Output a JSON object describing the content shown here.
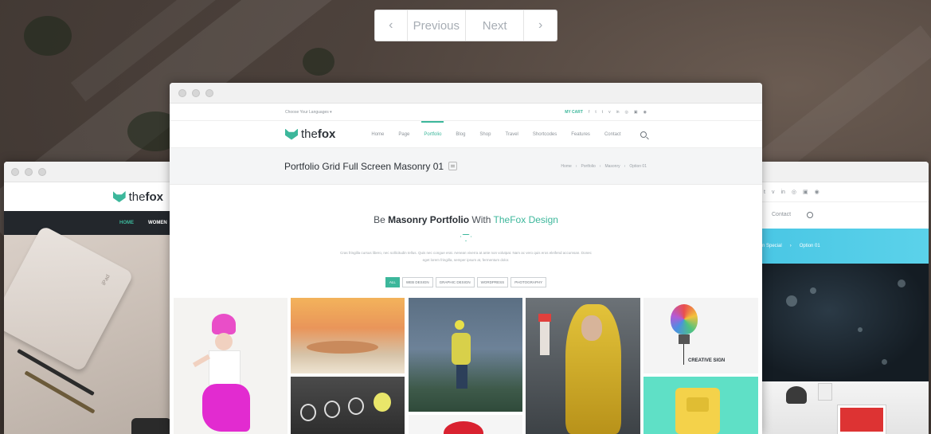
{
  "pager": {
    "prev_arrow": "‹",
    "previous": "Previous",
    "next": "Next",
    "next_arrow": "›"
  },
  "left_window": {
    "logo_pre": "the",
    "logo_bold": "fox",
    "nav": [
      "HOME",
      "WOMEN"
    ],
    "photo_text": "iPad"
  },
  "right_window": {
    "social": [
      "t",
      "v",
      "in",
      "◎",
      "▣",
      "◉"
    ],
    "nav": [
      "Contact"
    ],
    "breadcrumb_a": "n Special",
    "breadcrumb_sep": "›",
    "breadcrumb_b": "Option 01"
  },
  "main_window": {
    "topbar": {
      "language": "Choose Your Languages ▾",
      "cart": "MY CART",
      "social": [
        "f",
        "t",
        "t",
        "v",
        "in",
        "◎",
        "▣",
        "◉"
      ]
    },
    "logo_pre": "the",
    "logo_bold": "fox",
    "menu": [
      "Home",
      "Page",
      "Portfolio",
      "Blog",
      "Shop",
      "Travel",
      "Shortcodes",
      "Features",
      "Contact"
    ],
    "page_title": "Portfolio Grid Full Screen Masonry 01",
    "breadcrumbs": [
      "Home",
      "›",
      "Portfolio",
      "›",
      "Masonry",
      "›",
      "Option 01"
    ],
    "heading_pre": "Be ",
    "heading_bold": "Masonry Portfolio",
    "heading_mid": " With ",
    "heading_accent": "TheFox Design",
    "intro_text": "Cras fringilla cursus libero, nec sollicitudin tellus. Quis nec congue erat. Aenean viverra at ante non volutpat. Nam ac vero quis eros eleifend accumsan. Donec eget lorem fringilla, semper ipsum at, fermentum dolor.",
    "filters": [
      "ALL",
      "WEB DESIGN",
      "GRAPHIC DESIGN",
      "WORDPRESS",
      "PHOTOGRAPHY"
    ],
    "tile_text": "CREATIVE SIGN"
  },
  "colors": {
    "accent": "#3cb79b",
    "dark_nav": "#23272c",
    "blue_bar": "#49c6e4"
  }
}
